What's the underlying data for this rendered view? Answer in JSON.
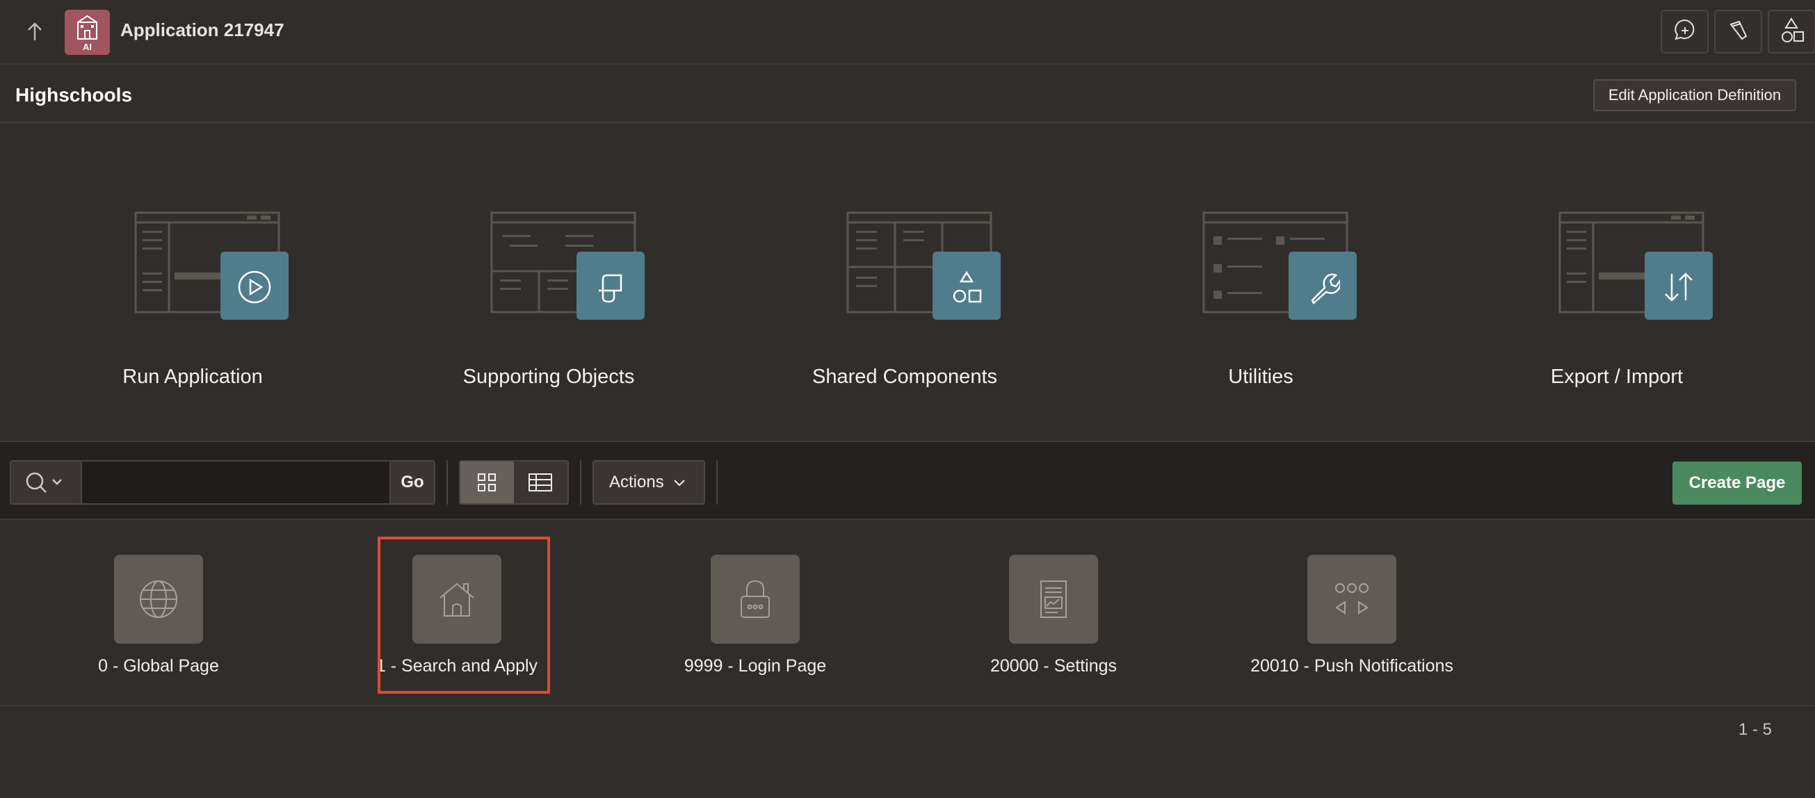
{
  "topbar": {
    "app_title": "Application 217947",
    "app_icon_text": "AI",
    "icons": [
      "arrow-up-icon",
      "feedback-icon",
      "flashlight-icon",
      "shapes-icon"
    ]
  },
  "header": {
    "title": "Highschools",
    "edit_button_label": "Edit Application Definition"
  },
  "tiles": [
    {
      "label": "Run Application",
      "icon": "play-icon"
    },
    {
      "label": "Supporting Objects",
      "icon": "scroll-icon"
    },
    {
      "label": "Shared Components",
      "icon": "shapes-icon"
    },
    {
      "label": "Utilities",
      "icon": "wrench-icon"
    },
    {
      "label": "Export / Import",
      "icon": "arrows-up-down-icon"
    }
  ],
  "toolbar": {
    "search_value": "",
    "go_label": "Go",
    "actions_label": "Actions",
    "create_page_label": "Create Page"
  },
  "pages": [
    {
      "label": "0 - Global Page",
      "icon": "globe-icon"
    },
    {
      "label": "1 - Search and Apply",
      "icon": "home-icon"
    },
    {
      "label": "9999 - Login Page",
      "icon": "lock-icon"
    },
    {
      "label": "20000 - Settings",
      "icon": "settings-page-icon"
    },
    {
      "label": "20010 - Push Notifications",
      "icon": "push-notification-icon"
    }
  ],
  "pagination": "1 - 5",
  "colors": {
    "background": "#312d2a",
    "toolbar_background": "#242120",
    "tile_accent": "#4f7d8c",
    "create_button": "#4b8a5e",
    "highlight": "#e04a2f",
    "app_icon": "#a1555f"
  }
}
